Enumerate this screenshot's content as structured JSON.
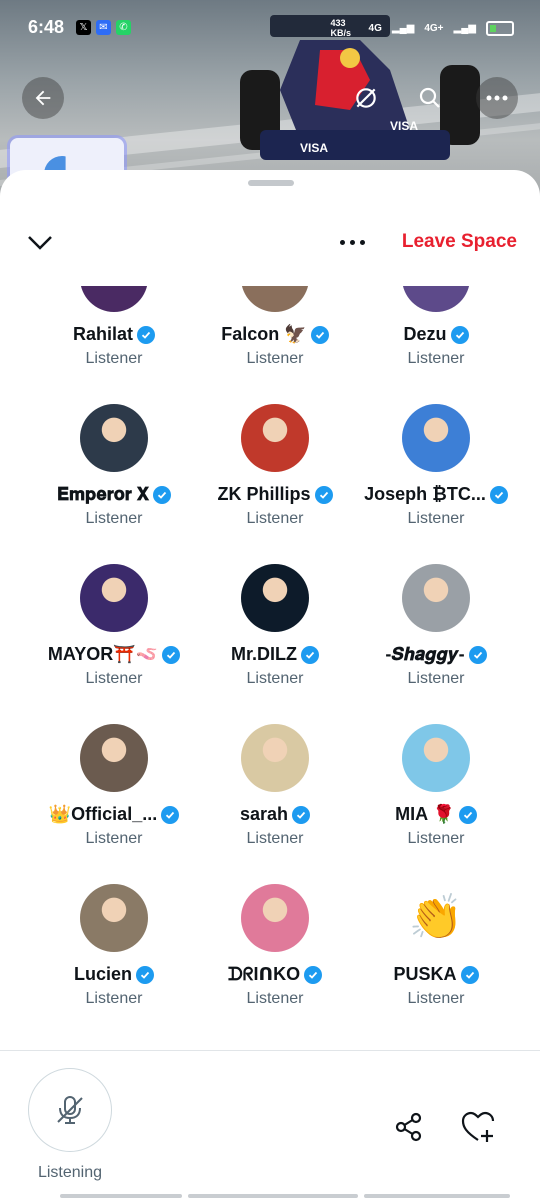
{
  "status_bar": {
    "time": "6:48",
    "net_speed": "433 KB/s",
    "network_1": "4G",
    "network_2": "4G+"
  },
  "header": {
    "leave_label": "Leave Space"
  },
  "participants": [
    {
      "name": "Rahilat",
      "role": "Listener",
      "verified": true,
      "avatar_color": "#4a2a63"
    },
    {
      "name": "Falcon 🦅",
      "role": "Listener",
      "verified": true,
      "avatar_color": "#8a6f5c"
    },
    {
      "name": "Dezu",
      "role": "Listener",
      "verified": true,
      "avatar_color": "#5d4a8a"
    },
    {
      "name": "𝐄𝐦𝐩𝐞𝐫𝐨𝐫 𝐗",
      "role": "Listener",
      "verified": true,
      "avatar_color": "#2d3a4a"
    },
    {
      "name": "ZK Phillips",
      "role": "Listener",
      "verified": true,
      "avatar_color": "#c0392b"
    },
    {
      "name": "Joseph ₿TC...",
      "role": "Listener",
      "verified": true,
      "avatar_color": "#3d7fd6"
    },
    {
      "name": "MAYOR⛩️🪱",
      "role": "Listener",
      "verified": true,
      "avatar_color": "#3b2a6b"
    },
    {
      "name": "Mr.DILZ",
      "role": "Listener",
      "verified": true,
      "avatar_color": "#0d1b2a"
    },
    {
      "name": "-𝑺𝒉𝒂𝒈𝒈𝒚-",
      "role": "Listener",
      "verified": true,
      "avatar_color": "#9aa0a6"
    },
    {
      "name": "👑Official_...",
      "role": "Listener",
      "verified": true,
      "avatar_color": "#6b5b4f"
    },
    {
      "name": "sarah",
      "role": "Listener",
      "verified": true,
      "avatar_color": "#d9c9a3"
    },
    {
      "name": "MIA 🌹",
      "role": "Listener",
      "verified": true,
      "avatar_color": "#7fc7e8"
    },
    {
      "name": "Lucien",
      "role": "Listener",
      "verified": true,
      "avatar_color": "#8a7a66"
    },
    {
      "name": "ᗪᖇIᑎKO",
      "role": "Listener",
      "verified": true,
      "avatar_color": "#e07a9a"
    },
    {
      "name": "PUSKA",
      "role": "Listener",
      "verified": true,
      "avatar_color": "#ffffff",
      "avatar_emoji": "👏"
    }
  ],
  "footer": {
    "listening_label": "Listening"
  },
  "colors": {
    "accent": "#1d9bf0",
    "leave": "#e8202f",
    "secondary_text": "#536471"
  }
}
